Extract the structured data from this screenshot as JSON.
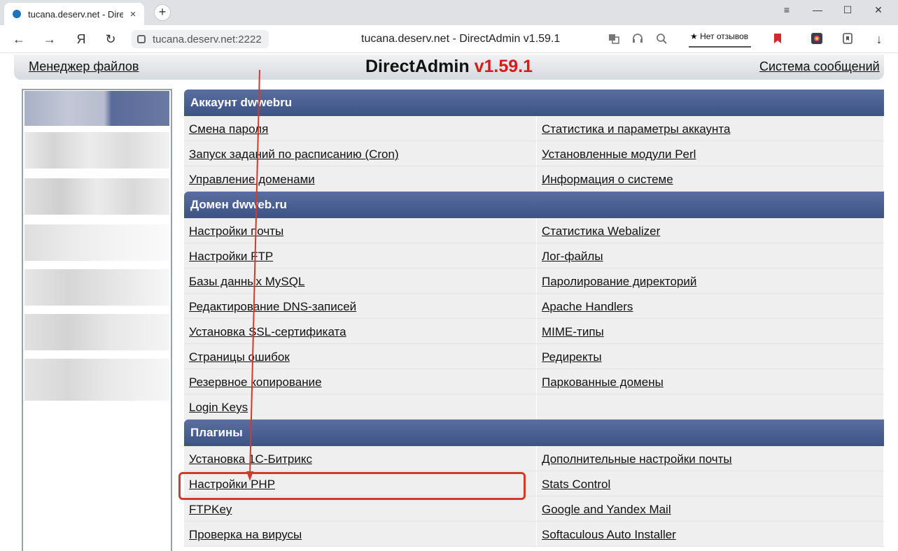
{
  "browser": {
    "tab_title": "tucana.deserv.net - Dire",
    "tab_close": "×",
    "new_tab": "+",
    "address": "tucana.deserv.net:2222",
    "page_title": "tucana.deserv.net - DirectAdmin v1.59.1",
    "review_label": "★ Нет отзывов",
    "nav": {
      "back": "←",
      "forward": "→",
      "yandex": "Я",
      "reload": "↻",
      "download": "↓"
    },
    "window": {
      "menu": "≡",
      "minimize": "—",
      "maximize": "☐",
      "close": "✕"
    }
  },
  "header": {
    "file_manager": "Менеджер файлов",
    "brand": "DirectAdmin",
    "version": "v1.59.1",
    "messages": "Система сообщений"
  },
  "sections": [
    {
      "title": "Аккаунт dwwebru",
      "rows": [
        [
          "Смена пароля",
          "Статистика и параметры аккаунта"
        ],
        [
          "Запуск заданий по расписанию (Cron)",
          "Установленные модули Perl"
        ],
        [
          "Управление доменами",
          "Информация о системе"
        ]
      ]
    },
    {
      "title": "Домен dwweb.ru",
      "rows": [
        [
          "Настройки почты",
          "Статистика Webalizer"
        ],
        [
          "Настройки FTP",
          "Лог-файлы"
        ],
        [
          "Базы данных MySQL",
          "Паролирование директорий"
        ],
        [
          "Редактирование DNS-записей",
          "Apache Handlers"
        ],
        [
          "Установка SSL-сертификата",
          "MIME-типы"
        ],
        [
          "Страницы ошибок",
          "Редиректы"
        ],
        [
          "Резервное копирование",
          "Паркованные домены"
        ],
        [
          "Login Keys",
          ""
        ]
      ]
    },
    {
      "title": "Плагины",
      "rows": [
        [
          "Установка 1С-Битрикс",
          "Дополнительные настройки почты"
        ],
        [
          "Настройки PHP",
          "Stats Control"
        ],
        [
          "FTPKey",
          "Google and Yandex Mail"
        ],
        [
          "Проверка на вирусы",
          "Softaculous Auto Installer"
        ]
      ]
    }
  ],
  "annotation": {
    "highlighted_item": "Настройки PHP",
    "highlight_color": "#d23a2a"
  },
  "colors": {
    "section_header": "#46598c",
    "version": "#d51c1c"
  }
}
